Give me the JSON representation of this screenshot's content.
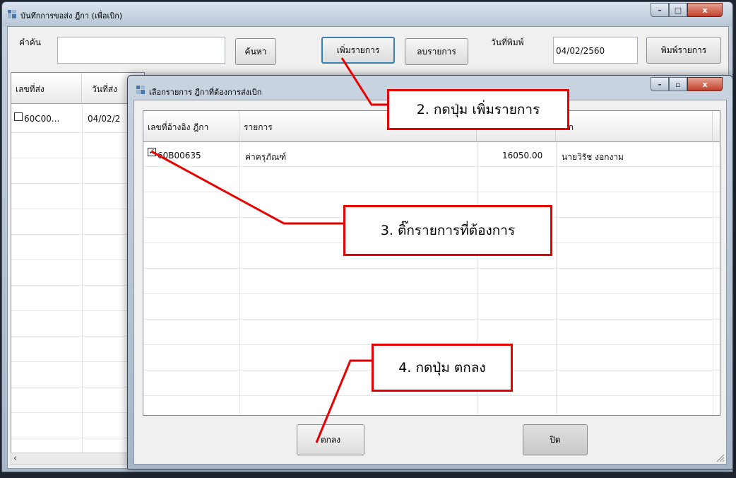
{
  "main_window": {
    "title": "บันทึกการขอส่ง ฎีกา (เพื่อเบิก)",
    "search_label": "คำค้น",
    "search_value": "",
    "search_button": "ค้นหา",
    "add_button": "เพิ่มรายการ",
    "delete_button": "ลบรายการ",
    "print_date_label": "วันที่พิมพ์",
    "print_date_value": "04/02/2560",
    "print_button": "พิมพ์รายการ",
    "caption": {
      "minimize": "–",
      "maximize": "□",
      "close": "x"
    },
    "grid": {
      "columns": [
        "เลขที่ส่ง",
        "วันที่ส่ง"
      ],
      "rows": [
        {
          "checked": false,
          "doc_no": "60C00...",
          "date": "04/02/2"
        }
      ]
    },
    "scroll_left_arrow": "‹"
  },
  "dialog": {
    "title": "เลือกรายการ ฎีกาที่ต้องการส่งเบิก",
    "caption": {
      "minimize": "–",
      "maximize": "▫",
      "close": "x"
    },
    "grid": {
      "columns": [
        "เลขที่อ้างอิง ฎีกา",
        "รายการ",
        "",
        "เบิก"
      ],
      "rows": [
        {
          "checked": true,
          "ref_no": "60B00635",
          "item": "ค่าครุภัณฑ์",
          "amount": "16050.00",
          "person": "นายวิรัช งอกงาม"
        }
      ]
    },
    "ok_button": "ตกลง",
    "close_button": "ปิด"
  },
  "callouts": {
    "step2": "2. กดปุ่ม เพิ่มรายการ",
    "step3": "3. ติ๊กรายการที่ต้องการ",
    "step4": "4. กดปุ่ม ตกลง"
  },
  "colors": {
    "callout_border": "#e60000",
    "arrow": "#e60000"
  }
}
